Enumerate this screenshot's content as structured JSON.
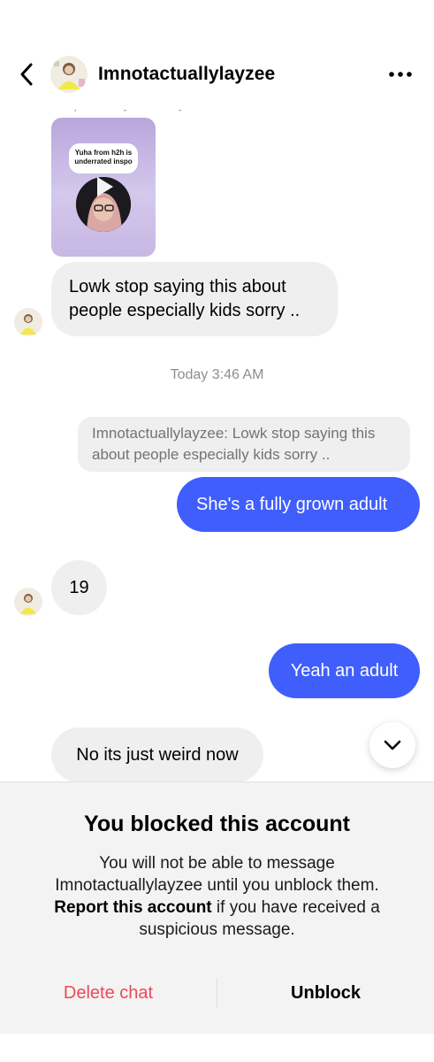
{
  "header": {
    "username": "Imnotactuallylayzee",
    "icons": {
      "back": "chevron-left-icon",
      "more": "more-horizontal-icon"
    }
  },
  "story_reply": {
    "label": "Replied to your story",
    "sticker_text": "Yuha from h2h is underrated inspo"
  },
  "messages": [
    {
      "from": "them",
      "text": "Lowk stop saying this about people especially kids sorry .."
    },
    {
      "from": "me_quote",
      "text": "Imnotactuallylayzee: Lowk stop saying this about people especially kids sorry .."
    },
    {
      "from": "me",
      "text": "She's a fully grown adult"
    },
    {
      "from": "them",
      "text": "19"
    },
    {
      "from": "me",
      "text": "Yeah an adult"
    },
    {
      "from": "them",
      "text": "No its just weird now"
    }
  ],
  "timestamp": "Today 3:46 AM",
  "blocked": {
    "title": "You blocked this account",
    "desc_before": "You will not be able to message Imnotactuallylayzee until you unblock them.",
    "report_link": "Report this account",
    "desc_after": "if you have received a suspicious message.",
    "delete_label": "Delete chat",
    "unblock_label": "Unblock"
  },
  "colors": {
    "outgoing_bubble": "#3f5efb",
    "incoming_bubble": "#efefef",
    "destructive": "#ed4956",
    "panel_bg": "#f3f3f3"
  }
}
